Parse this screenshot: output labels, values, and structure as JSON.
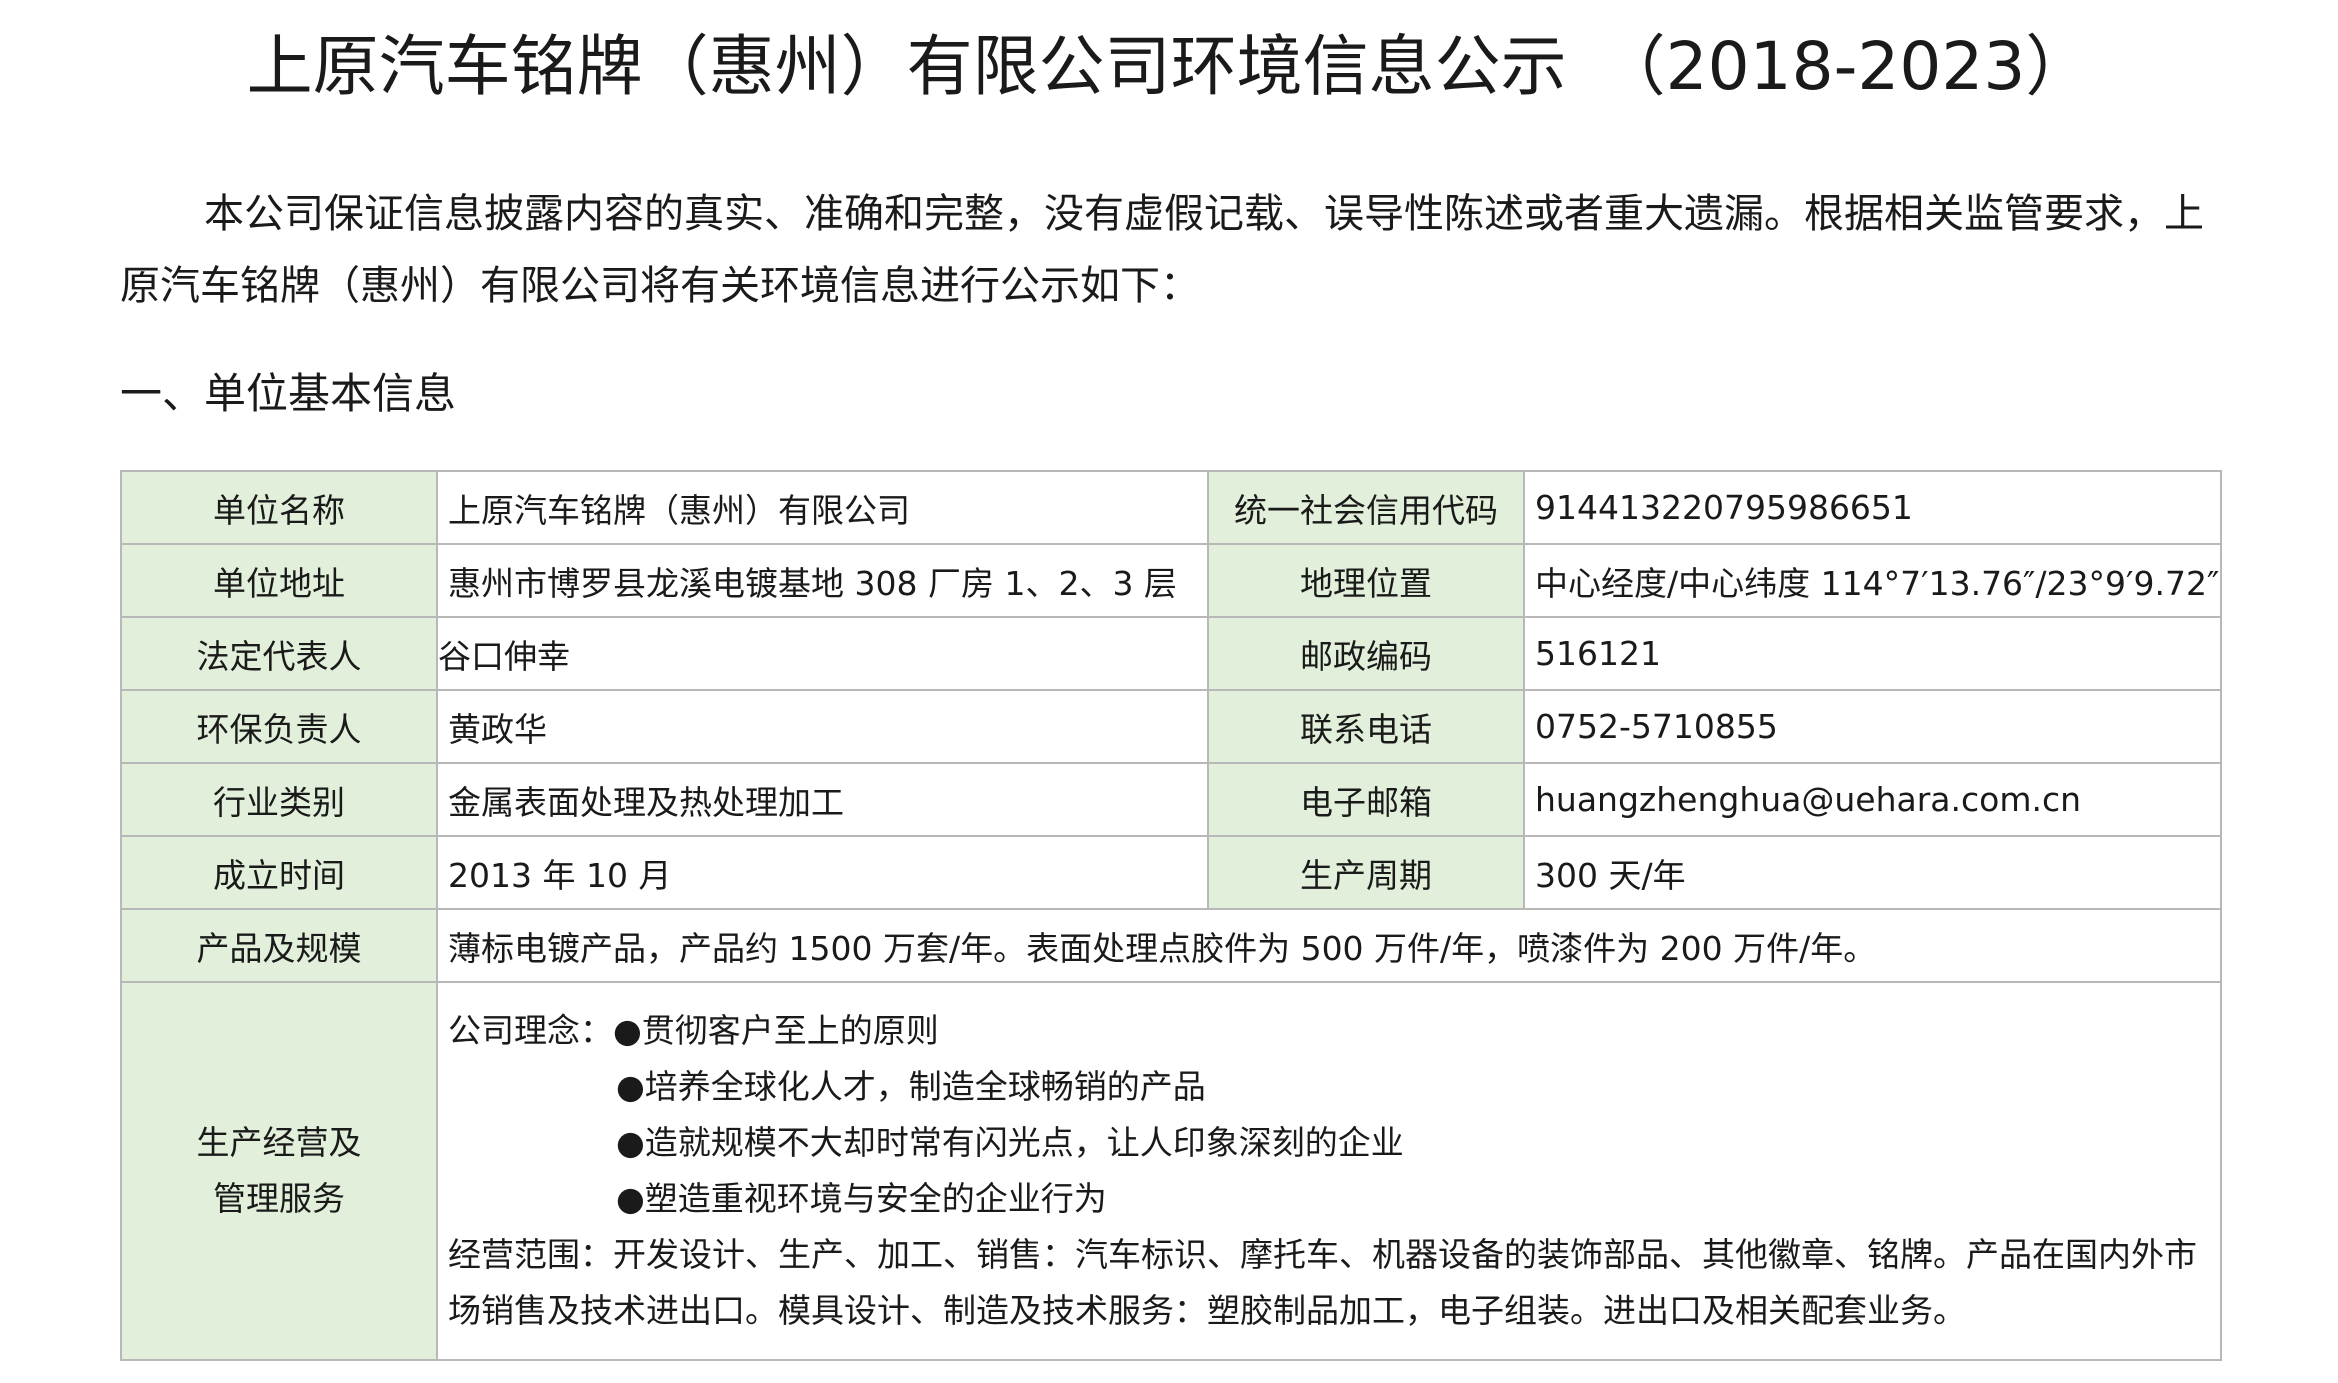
{
  "title": "上原汽车铭牌（惠州）有限公司环境信息公示　（2018-2023）",
  "intro": "本公司保证信息披露内容的真实、准确和完整，没有虚假记载、误导性陈述或者重大遗漏。根据相关监管要求，上原汽车铭牌（惠州）有限公司将有关环境信息进行公示如下：",
  "section1_heading": "一、单位基本信息",
  "table": {
    "rows": [
      {
        "label1": "单位名称",
        "value1": "上原汽车铭牌（惠州）有限公司",
        "label2": "统一社会信用代码",
        "value2": "91441322079598665​1"
      },
      {
        "label1": "单位地址",
        "value1": "惠州市博罗县龙溪电镀基地 308 厂房 1、2、3 层",
        "label2": "地理位置",
        "value2": "中心经度/中心纬度 114°7′13.76″/23°9′9.72″"
      },
      {
        "label1": "法定代表人",
        "value1": "谷口伸幸",
        "label2": "邮政编码",
        "value2": "516121"
      },
      {
        "label1": "环保负责人",
        "value1": "黄政华",
        "label2": "联系电话",
        "value2": "0752-5710855"
      },
      {
        "label1": "行业类别",
        "value1": "金属表面处理及热处理加工",
        "label2": "电子邮箱",
        "value2": "huangzhenghua@uehara.com.cn"
      },
      {
        "label1": "成立时间",
        "value1": "2013 年 10 月",
        "label2": "生产周期",
        "value2": "300 天/年"
      }
    ],
    "products": {
      "label": "产品及规模",
      "value": "薄标电镀产品，产品约 1500 万套/年。表面处理点胶件为 500 万件/年，喷漆件为 200 万件/年。"
    },
    "management": {
      "label_line1": "生产经营及",
      "label_line2": "管理服务",
      "philosophy_1": "公司理念：●贯彻客户至上的原则",
      "philosophy_2": "●培养全球化人才，制造全球畅销的产品",
      "philosophy_3": "●造就规模不大却时常有闪光点，让人印象深刻的企业",
      "philosophy_4": "●塑造重视环境与安全的企业行为",
      "scope": "经营范围：开发设计、生产、加工、销售：汽车标识、摩托车、机器设备的装饰部品、其他徽章、铭牌。产品在国内外市场销售及技术进出口。模具设计、制造及技术服务：塑胶制品加工，电子组装。进出口及相关配套业务。"
    }
  },
  "colors": {
    "label_background": "#e2efda",
    "border": "#b8b8b8",
    "text": "#1a1a1a"
  }
}
